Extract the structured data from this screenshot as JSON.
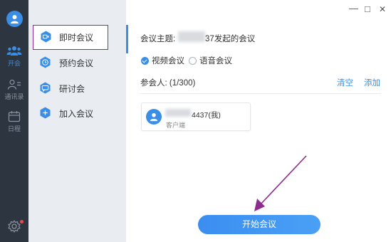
{
  "rail": {
    "items": [
      {
        "label": "开会",
        "icon": "people-icon",
        "active": true
      },
      {
        "label": "通讯录",
        "icon": "contacts-icon",
        "active": false
      },
      {
        "label": "日程",
        "icon": "calendar-icon",
        "active": false
      }
    ]
  },
  "menu": {
    "items": [
      {
        "label": "即时会议",
        "icon": "video-camera-icon"
      },
      {
        "label": "预约会议",
        "icon": "clock-icon"
      },
      {
        "label": "研讨会",
        "icon": "chat-bubble-icon"
      },
      {
        "label": "加入会议",
        "icon": "plus-icon"
      }
    ]
  },
  "window": {
    "minimize": "—",
    "maximize": "□",
    "close": "✕"
  },
  "meeting": {
    "topic_label": "会议主题:",
    "topic_value": "37发起的会议",
    "type_video": "视频会议",
    "type_voice": "语音会议",
    "participants_label": "参会人: (1/300)",
    "clear_label": "清空",
    "add_label": "添加",
    "participant_name": "4437(我)",
    "participant_sub": "客户端",
    "start_label": "开始会议"
  },
  "colors": {
    "accent": "#3a8ee6",
    "rail_bg": "#2c3540",
    "menu_bg": "#e9edf2",
    "highlight_border": "#8e2c8e",
    "arrow": "#8e2c8e"
  }
}
